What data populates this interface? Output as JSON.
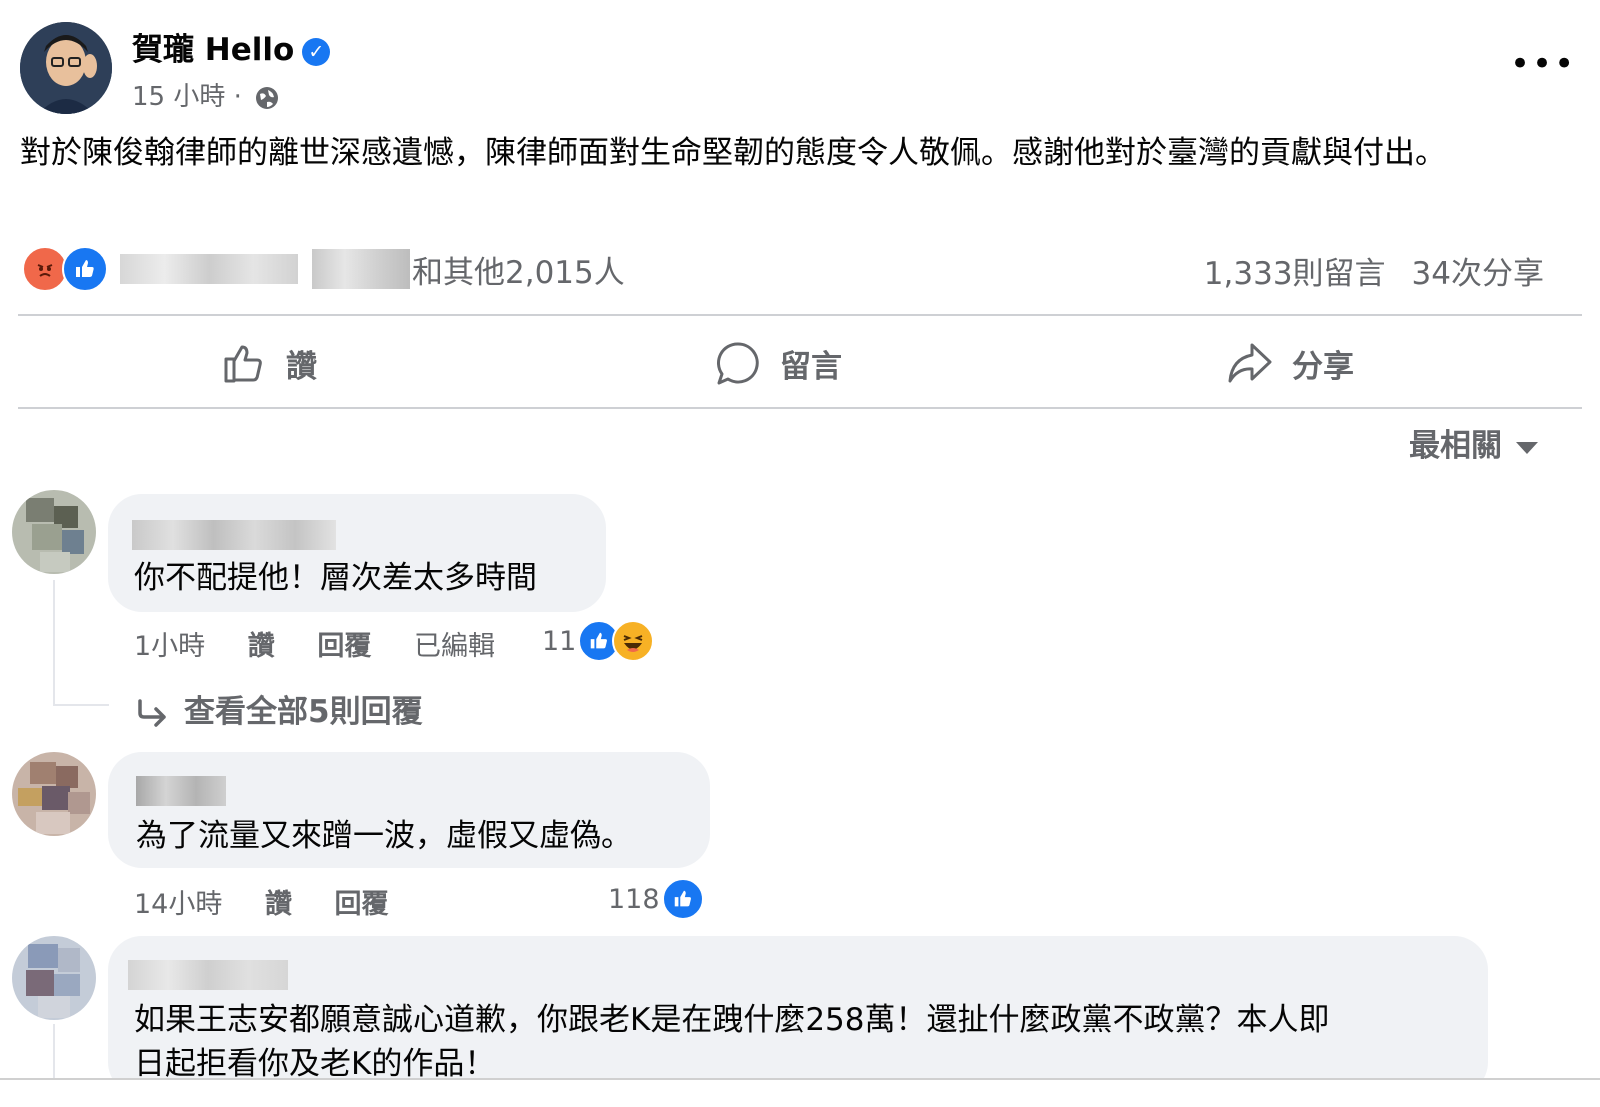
{
  "post": {
    "author": "賀瓏 Hello",
    "time": "15 小時 ·",
    "more_label": "•••",
    "text": "對於陳俊翰律師的離世深感遺憾，陳律師面對生命堅韌的態度令人敬佩。感謝他對於臺灣的貢獻與付出。",
    "reactions_text": "和其他2,015人",
    "comments_count": "1,333則留言",
    "shares_count": "34次分享"
  },
  "actions": {
    "like": "讚",
    "comment": "留言",
    "share": "分享"
  },
  "sort_label": "最相關",
  "comments": [
    {
      "text": "你不配提他！層次差太多時間",
      "time": "1小時",
      "like": "讚",
      "reply": "回覆",
      "edited": "已編輯",
      "reaction_count": "11"
    },
    {
      "text": "為了流量又來蹭一波，虛假又虛偽。",
      "time": "14小時",
      "like": "讚",
      "reply": "回覆",
      "reaction_count": "118"
    },
    {
      "text_line1": "如果王志安都願意誠心道歉，你跟老K是在跩什麼258萬！還扯什麼政黨不政黨？本人即",
      "text_line2": "日起拒看你及老K的作品！"
    }
  ],
  "view_replies": "查看全部5則回覆",
  "colors": {
    "like_blue": "#1877f2",
    "angry_orange": "#f0684a",
    "haha_yellow": "#f7b125",
    "secondary_text": "#65676b",
    "bubble_bg": "#f0f2f5"
  }
}
